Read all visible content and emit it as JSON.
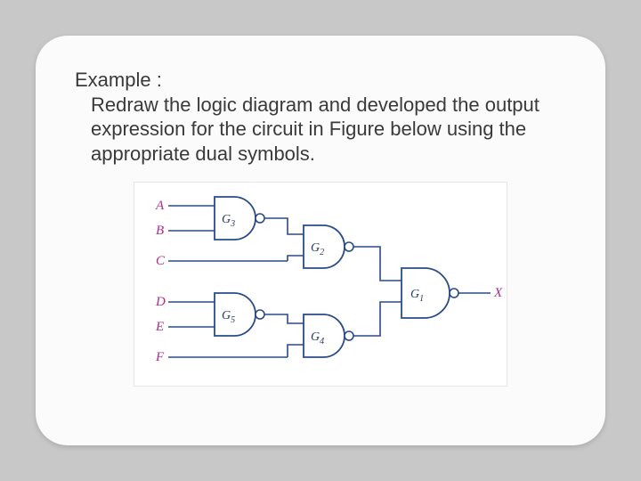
{
  "text": {
    "line1": "Example :",
    "rest": "Redraw the logic diagram and developed the output expression for the circuit in Figure below using the appropriate dual symbols."
  },
  "diagram": {
    "inputs": [
      "A",
      "B",
      "C",
      "D",
      "E",
      "F"
    ],
    "output": "X",
    "gates": [
      {
        "id": "G3",
        "type": "NAND",
        "inputs": [
          "A",
          "B"
        ]
      },
      {
        "id": "G5",
        "type": "NAND",
        "inputs": [
          "D",
          "E"
        ]
      },
      {
        "id": "G2",
        "type": "NAND",
        "inputs": [
          "G3",
          "C"
        ]
      },
      {
        "id": "G4",
        "type": "NAND",
        "inputs": [
          "G5",
          "F"
        ]
      },
      {
        "id": "G1",
        "type": "NAND",
        "inputs": [
          "G2",
          "G4"
        ]
      }
    ],
    "labels": {
      "G1": "G",
      "G1sub": "1",
      "G2": "G",
      "G2sub": "2",
      "G3": "G",
      "G3sub": "3",
      "G4": "G",
      "G4sub": "4",
      "G5": "G",
      "G5sub": "5"
    }
  }
}
